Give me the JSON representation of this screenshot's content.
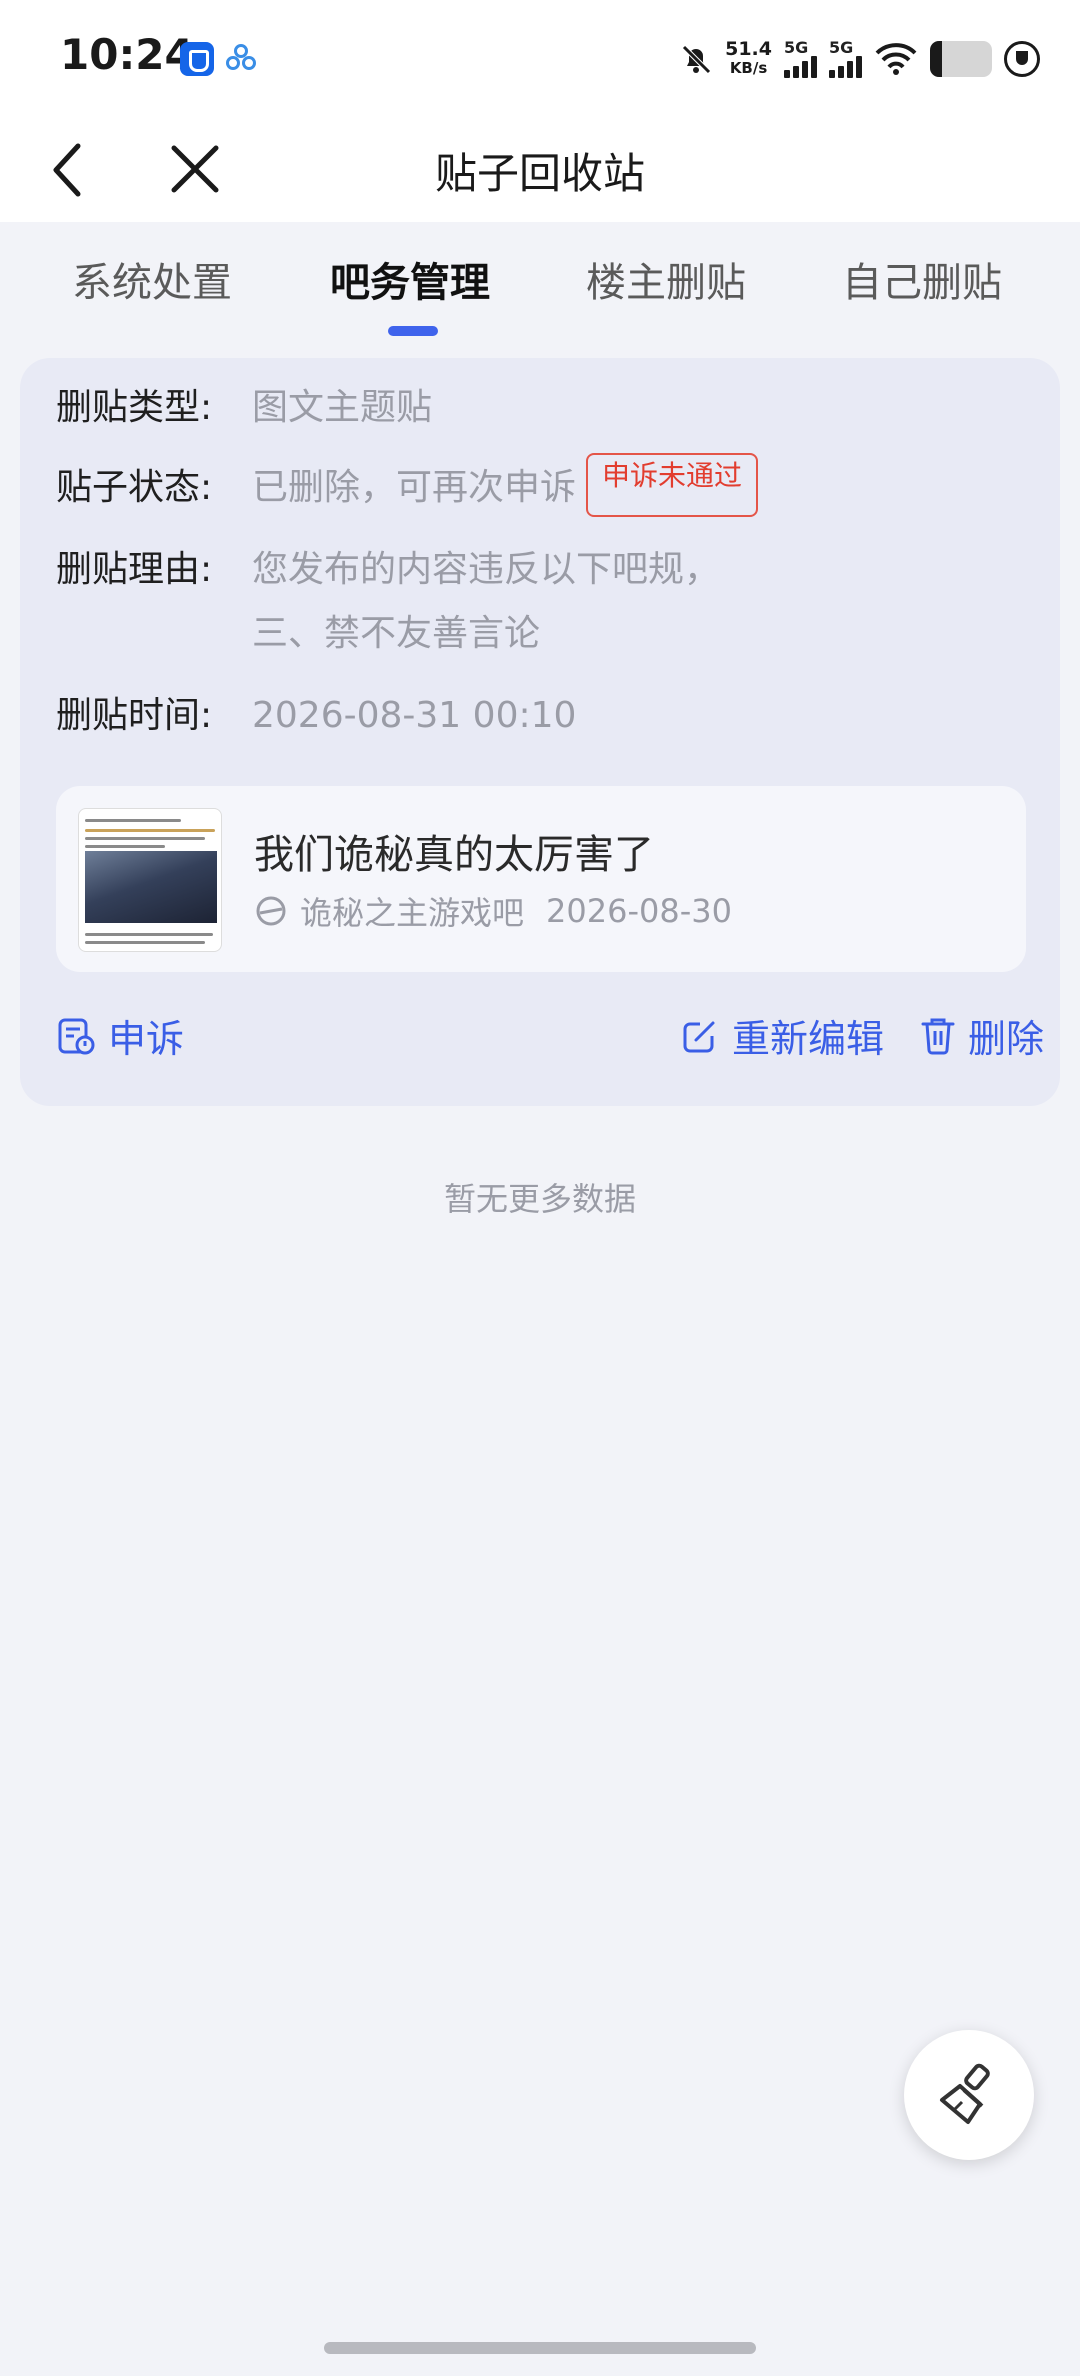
{
  "status_bar": {
    "time": "10:24",
    "net_speed_value": "51.4",
    "net_speed_unit": "KB/s",
    "signal1_label": "5G",
    "signal2_label": "5G",
    "icons": [
      "app-shield-icon",
      "app-baidu-icon",
      "bell-muted-icon",
      "signal-icon",
      "wifi-icon",
      "battery-icon",
      "charging-icon"
    ]
  },
  "nav": {
    "title": "贴子回收站"
  },
  "tabs": [
    {
      "label": "系统处置",
      "active": false
    },
    {
      "label": "吧务管理",
      "active": true
    },
    {
      "label": "楼主删贴",
      "active": false
    },
    {
      "label": "自己删贴",
      "active": false
    }
  ],
  "record": {
    "type_label": "删贴类型:",
    "type_value": "图文主题贴",
    "status_label": "贴子状态:",
    "status_value": "已删除，可再次申诉",
    "status_badge": "申诉未通过",
    "reason_label": "删贴理由:",
    "reason_line1": "您发布的内容违反以下吧规，",
    "reason_line2": "三、禁不友善言论",
    "time_label": "删贴时间:",
    "time_value": "2026-08-31 00:10",
    "post": {
      "title": "我们诡秘真的太厉害了",
      "forum": "诡秘之主游戏吧",
      "date": "2026-08-30"
    },
    "actions": {
      "appeal": "申诉",
      "reedit": "重新编辑",
      "delete": "删除"
    }
  },
  "footer": {
    "no_more": "暂无更多数据"
  },
  "colors": {
    "accent": "#3f63ec",
    "badge_red": "#e23d2f",
    "card_bg": "#e8eaf5",
    "page_bg": "#f2f3f8"
  }
}
